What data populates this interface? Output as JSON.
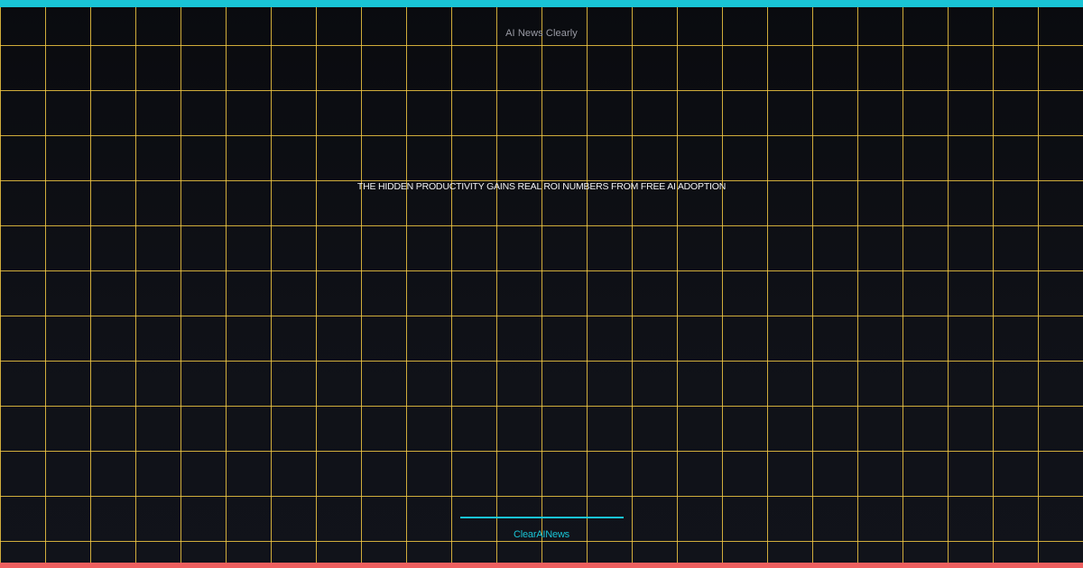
{
  "site_name": "AI News Clearly",
  "headline": "THE HIDDEN PRODUCTIVITY GAINS REAL ROI NUMBERS FROM FREE AI ADOPTION",
  "brand": "ClearAINews",
  "colors": {
    "accent_cyan": "#19c4d6",
    "accent_coral": "#ef5f5f",
    "grid_gold": "#f2c842",
    "background": "#0e1016"
  }
}
